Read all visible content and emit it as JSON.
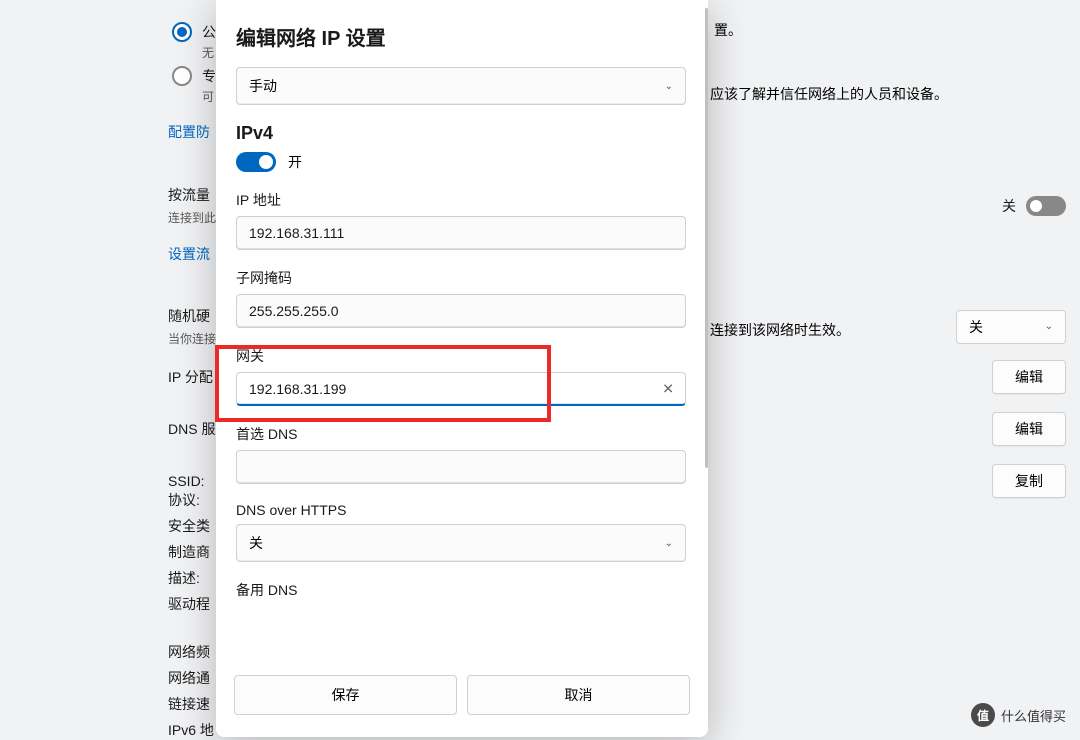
{
  "background": {
    "radio_public": {
      "label": "公",
      "sub": "无"
    },
    "radio_private": {
      "label": "专",
      "sub": "可"
    },
    "private_hint": "应该了解并信任网络上的人员和设备。",
    "configure_firewall_link": "配置防",
    "metered": {
      "label": "按流量",
      "sub": "连接到此"
    },
    "metered_toggle": "关",
    "set_data_link": "设置流",
    "random_hw": {
      "label": "随机硬",
      "sub": "当你连接",
      "hint": "连接到该网络时生效。"
    },
    "random_hw_select": "关",
    "ip_assign": {
      "label": "IP 分配",
      "button": "编辑"
    },
    "dns_assign": {
      "label": "DNS 服",
      "button": "编辑"
    },
    "ssid": {
      "label": "SSID:",
      "button": "复制"
    },
    "protocol": "协议:",
    "security": "安全类",
    "manufacturer": "制造商",
    "description": "描述:",
    "driver": "驱动程",
    "band": "网络频",
    "channel": "网络通",
    "link_speed": "链接速",
    "ipv6": "IPv6 地"
  },
  "dialog": {
    "title": "编辑网络 IP 设置",
    "mode_select": "手动",
    "ipv4_header": "IPv4",
    "ipv4_toggle": "开",
    "ip_label": "IP 地址",
    "ip_value": "192.168.31.111",
    "subnet_label": "子网掩码",
    "subnet_value": "255.255.255.0",
    "gateway_label": "网关",
    "gateway_value": "192.168.31.199",
    "dns1_label": "首选 DNS",
    "dns1_value": "",
    "doh_label": "DNS over HTTPS",
    "doh_value": "关",
    "dns2_label": "备用 DNS",
    "save": "保存",
    "cancel": "取消"
  },
  "watermark": {
    "badge": "值",
    "text": "什么值得买"
  }
}
